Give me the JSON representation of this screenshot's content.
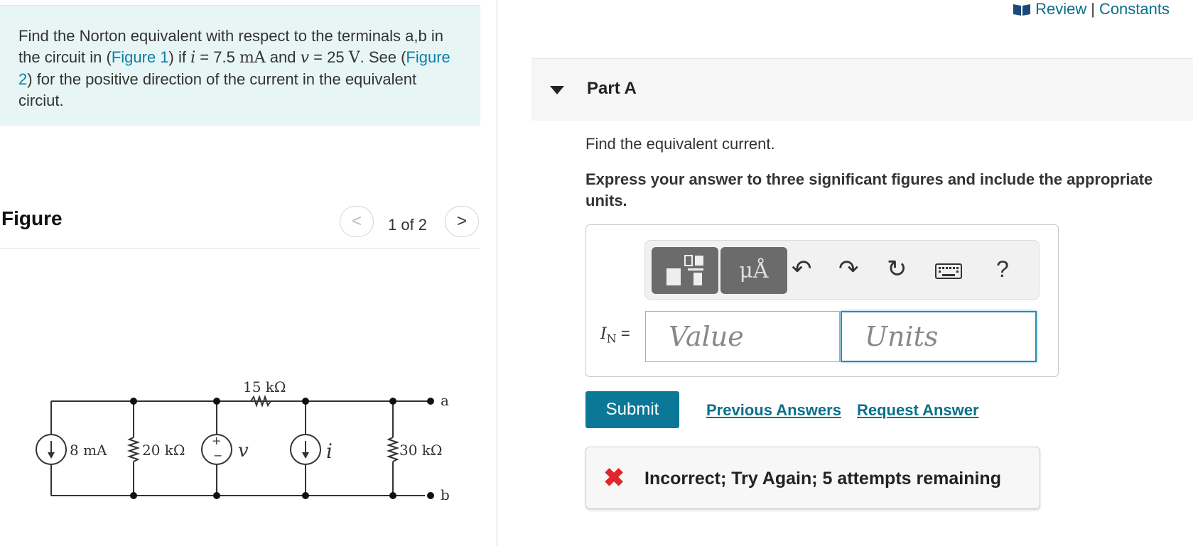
{
  "problem": {
    "text_a": "Find the Norton equivalent with respect to the terminals a,b in the circuit in (",
    "figure1_link": "Figure 1",
    "text_b": ") if ",
    "var_i": "i",
    "text_c": " = 7.5 ",
    "unit_ma": "mA",
    "text_d": " and ",
    "var_v": "v",
    "text_e": " = 25 ",
    "unit_v": "V",
    "text_f": ". See (",
    "figure2_link": "Figure 2",
    "text_g": ") for the positive direction of the current in the equivalent circiut."
  },
  "figure": {
    "title": "Figure",
    "pager": "1 of 2",
    "prev_glyph": "<",
    "next_glyph": ">",
    "circuit_labels": {
      "source_current": "8 mA",
      "r1": "20 kΩ",
      "r_top": "15 kΩ",
      "voltage_source": "v",
      "current_source": "i",
      "r2": "30 kΩ",
      "term_a": "a",
      "term_b": "b",
      "plus": "+",
      "minus": "−"
    }
  },
  "header": {
    "review": "Review",
    "separator": "|",
    "constants": "Constants"
  },
  "part": {
    "title": "Part A",
    "question": "Find the equivalent current.",
    "instruction": "Express your answer to three significant figures and include the appropriate units."
  },
  "answer": {
    "label_var": "I",
    "label_sub": "N",
    "label_eq": " =",
    "value_placeholder": "Value",
    "units_placeholder": "Units",
    "units_tool_label": "μÅ",
    "help_label": "?"
  },
  "actions": {
    "submit": "Submit",
    "previous_answers": "Previous Answers",
    "request_answer": "Request Answer"
  },
  "feedback": {
    "icon": "✖",
    "message": "Incorrect; Try Again; 5 attempts remaining"
  },
  "colors": {
    "accent": "#0b7898",
    "link": "#0b6f8a",
    "error": "#e0262b",
    "problem_bg": "#e8f5f5"
  }
}
